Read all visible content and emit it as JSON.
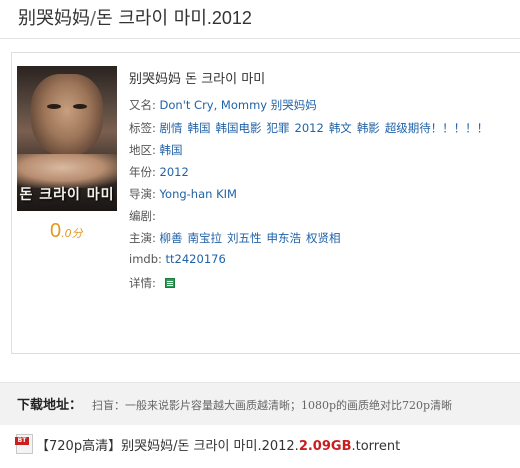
{
  "page": {
    "title_cn": "别哭妈妈",
    "title_sep": "/",
    "title_kr": "돈 크라이 마미",
    "title_year": ".2012"
  },
  "movie": {
    "poster_text": "돈 크라이 마미",
    "name": "别哭妈妈 돈 크라이 마미",
    "rating_value": "0",
    "rating_suffix": ".0分",
    "info": {
      "alias_label": "又名:",
      "alias_value": "Don't Cry, Mommy 别哭妈妈",
      "tags_label": "标签:",
      "tags": [
        "剧情",
        "韩国",
        "韩国电影",
        "犯罪",
        "2012",
        "韩文",
        "韩影",
        "超级期待！！！！！"
      ],
      "region_label": "地区:",
      "region_value": "韩国",
      "year_label": "年份:",
      "year_value": "2012",
      "director_label": "导演:",
      "director_value": "Yong-han KIM",
      "writer_label": "编剧:",
      "writer_value": "",
      "cast_label": "主演:",
      "cast": [
        "柳善",
        "南宝拉",
        "刘五性",
        "申东浩",
        "权贤相"
      ],
      "imdb_label": "imdb:",
      "imdb_value": "tt2420176",
      "detail_label": "详情:",
      "detail_icon": "document-icon"
    }
  },
  "download": {
    "title": "下载地址：",
    "hint": "扫盲：一般来说影片容量越大画质越清晰；1080p的画质绝对比720p清晰",
    "file": {
      "icon": "bt-torrent-icon",
      "icon_label": "BT",
      "prefix": "【720p高清】别哭妈妈/돈 크라이 마미.2012.",
      "size": "2.09GB",
      "ext": ".torrent"
    }
  },
  "colors": {
    "link": "#2062a8",
    "rating": "#e09a22",
    "size": "#c81e1e"
  }
}
